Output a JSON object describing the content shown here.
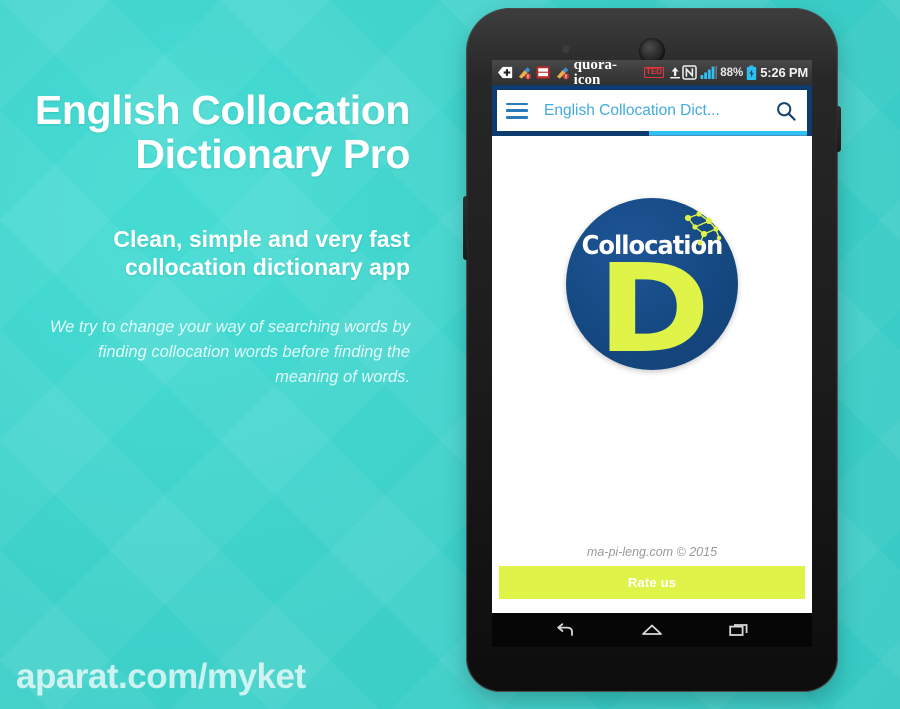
{
  "promo": {
    "title_line1": "English Collocation",
    "title_line2": "Dictionary Pro",
    "subtitle_line1": "Clean, simple and very fast",
    "subtitle_line2": "collocation dictionary app",
    "body_line1": "We try to change your way of searching words by",
    "body_line2": "finding collocation words before finding the",
    "body_line3": "meaning of words.",
    "watermark": "aparat.com/myket",
    "background_color": "#3ed3cc",
    "text_color": "#ffffff"
  },
  "phone": {
    "statusbar": {
      "icons_left": [
        "adblock-icon",
        "cleaner-icon",
        "battery-saver-icon",
        "cleaner-icon",
        "quora-icon",
        "ted-icon",
        "upload-icon"
      ],
      "nfc_label": "N",
      "signal_icon": "signal-bars-icon",
      "battery_percent": "88%",
      "battery_icon": "battery-charging-icon",
      "time": "5:26 PM",
      "background_color": "#3c3c3c",
      "accent_color": "#2ec0f4"
    },
    "appbar": {
      "menu_icon": "hamburger-menu-icon",
      "title": "English Collocation Dict...",
      "search_icon": "search-icon",
      "bar_color": "#0e3c6e",
      "title_color": "#41aade",
      "progress": {
        "indeterminate": true,
        "fill_start_percent": 49,
        "fill_width_percent": 51,
        "fill_color": "#2ec0f4"
      }
    },
    "content": {
      "logo": {
        "word": "Collocation",
        "letter": "D",
        "circle_color": "#164b85",
        "letter_color": "#dff349",
        "molecule_icon": "molecule-network-icon"
      },
      "credit": "ma-pi-leng.com © 2015",
      "rate_button_label": "Rate us",
      "rate_button_color": "#dff349"
    },
    "navbar": {
      "back_icon": "back-arrow-icon",
      "home_icon": "home-icon",
      "recents_icon": "recent-apps-icon"
    }
  }
}
